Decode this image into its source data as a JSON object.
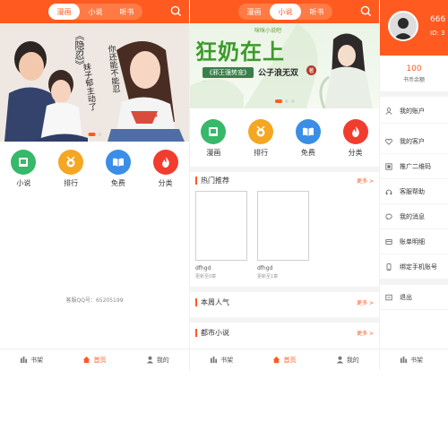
{
  "colors": {
    "accent": "#ff5a1f",
    "tab_bg": "#ff7a45",
    "novel": "#37b86a",
    "rank": "#f5a623",
    "free": "#3a8ee6",
    "category": "#f23c2e"
  },
  "top_tabs": [
    "漫画",
    "小说",
    "听书"
  ],
  "categories": [
    {
      "label": "小说",
      "icon": "book-icon"
    },
    {
      "label": "排行",
      "icon": "medal-icon"
    },
    {
      "label": "免费",
      "icon": "open-book-icon"
    },
    {
      "label": "分类",
      "icon": "flame-icon"
    }
  ],
  "categories_p2": [
    {
      "label": "漫画",
      "icon": "comic-icon"
    },
    {
      "label": "排行",
      "icon": "medal-icon"
    },
    {
      "label": "免费",
      "icon": "open-book-icon"
    },
    {
      "label": "分类",
      "icon": "flame-icon"
    }
  ],
  "banner1": {
    "title_text": "《隐忍》",
    "sub_left": "妹子郁主动了",
    "sub_right": "你还能不能忍",
    "shirt": "GUESS"
  },
  "banner2": {
    "logo": "咪咪小说吧",
    "title": "狂奶在上",
    "subtitle": "《邪王强势宠》",
    "author": "公子浪无双",
    "tag": "著",
    "blurb": "..."
  },
  "service_qq": "客服QQ号：65205199",
  "bottom_nav": [
    {
      "label": "书架",
      "icon": "shelf-icon"
    },
    {
      "label": "首页",
      "icon": "home-icon"
    },
    {
      "label": "我的",
      "icon": "user-icon"
    }
  ],
  "sections": [
    {
      "title": "热门推荐",
      "more": "更多 >"
    },
    {
      "title": "本周人气",
      "more": "更多 >"
    },
    {
      "title": "都市小说",
      "more": "更多 >"
    }
  ],
  "books": [
    {
      "title": "dfhgd",
      "update": "更新至0章"
    },
    {
      "title": "dfhgd",
      "update": "更新至1章"
    }
  ],
  "profile": {
    "user": "666",
    "id": "ID: 3",
    "coins": "100",
    "coins_label": "书币余额"
  },
  "menu": [
    {
      "label": "我的账户",
      "icon": "user-outline-icon"
    },
    {
      "label": "我的客户",
      "icon": "heart-icon"
    },
    {
      "label": "推广二维码",
      "icon": "qr-icon"
    },
    {
      "label": "客服帮助",
      "icon": "headset-icon"
    },
    {
      "label": "我的消息",
      "icon": "chat-icon"
    },
    {
      "label": "账单明细",
      "icon": "bill-icon"
    },
    {
      "label": "绑定手机账号",
      "icon": "phone-icon"
    },
    {
      "label": "退出",
      "icon": "exit-icon"
    }
  ]
}
